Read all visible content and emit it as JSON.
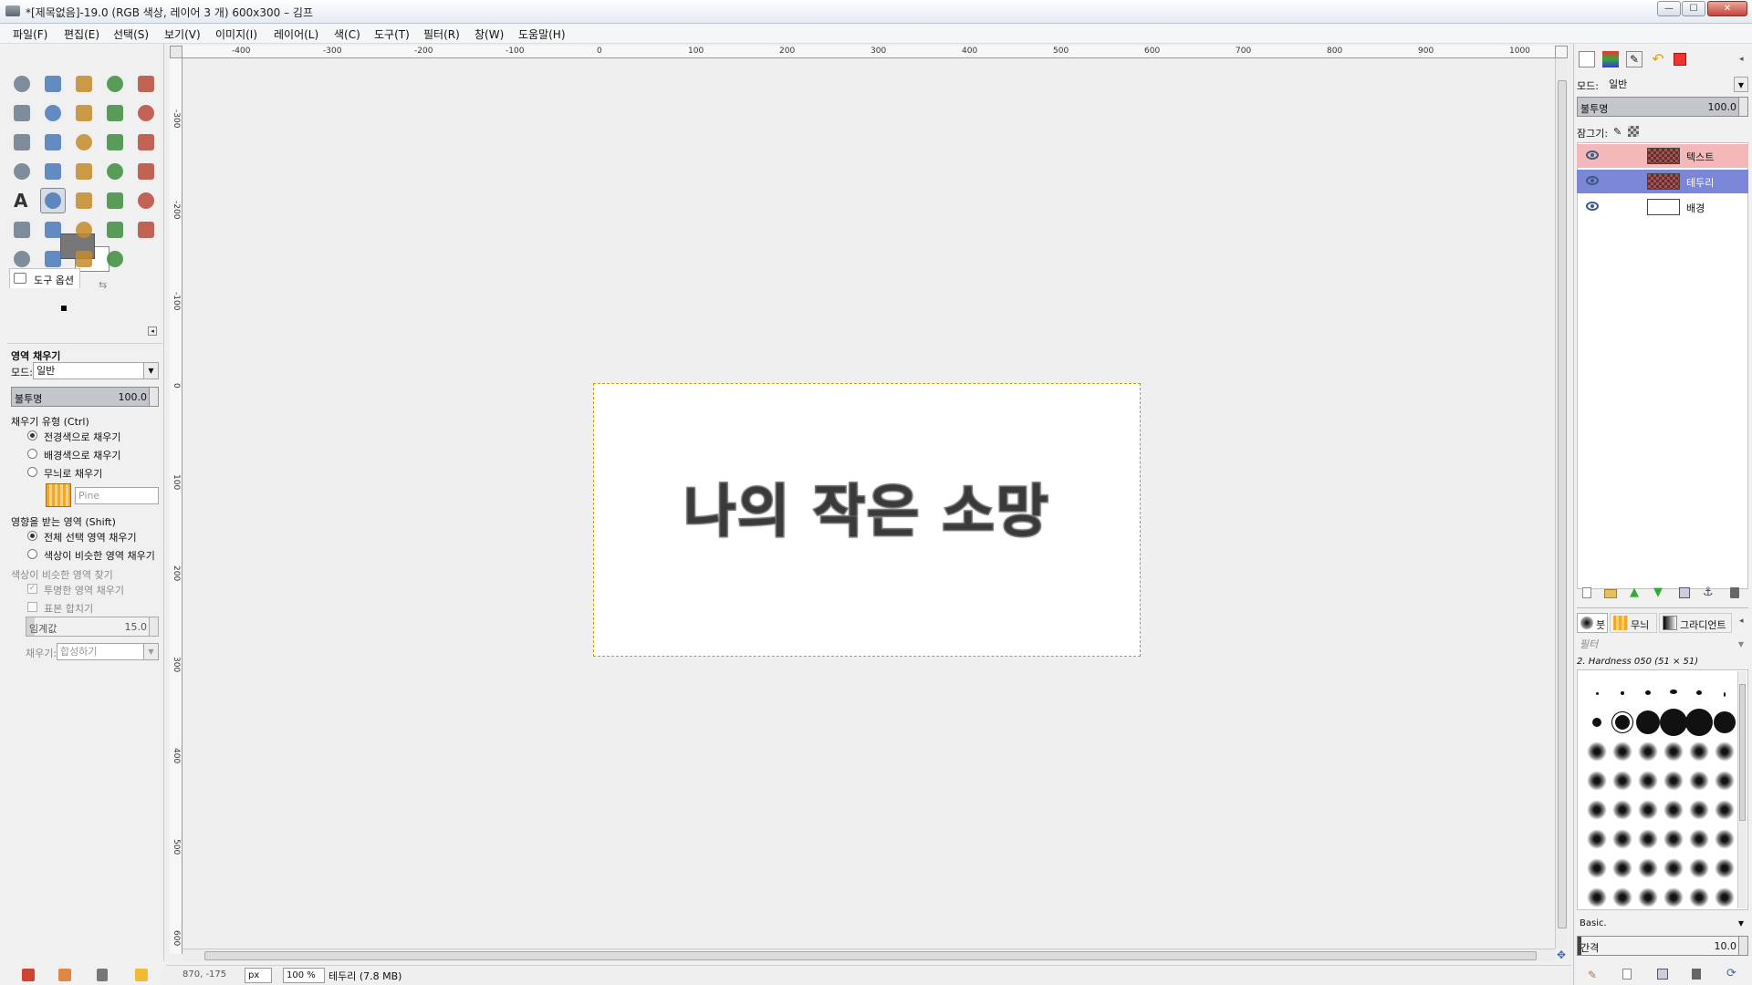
{
  "window": {
    "title": "*[제목없음]-19.0 (RGB 색상, 레이어 3 개) 600x300 – 김프",
    "buttons": {
      "minimize": "—",
      "maximize": "☐",
      "close": "✕"
    }
  },
  "menu": [
    "파일(F)",
    "편집(E)",
    "선택(S)",
    "보기(V)",
    "이미지(I)",
    "레이어(L)",
    "색(C)",
    "도구(T)",
    "필터(R)",
    "창(W)",
    "도움말(H)"
  ],
  "toolbox": {
    "tools": [
      "rect-select",
      "ellipse-select",
      "free-select",
      "fuzzy-select",
      "color-select",
      "scissors-select",
      "foreground-select",
      "paths",
      "color-picker",
      "zoom",
      "measure",
      "move",
      "align",
      "crop",
      "rotate",
      "scale",
      "shear",
      "perspective",
      "flip",
      "cage-transform",
      "text",
      "bucket-fill",
      "blend",
      "pencil",
      "paintbrush",
      "eraser",
      "airbrush",
      "ink",
      "clone",
      "heal",
      "perspective-clone",
      "blur",
      "smudge",
      "dodge-burn"
    ],
    "active_tool": "bucket-fill"
  },
  "tool_options": {
    "tab_label": "도구 옵션",
    "heading": "영역 채우기",
    "mode_label": "모드:",
    "mode_value": "일반",
    "opacity_label": "불투명",
    "opacity_value": "100.0",
    "opacity_fraction": 1.0,
    "fill_type_label": "채우기 유형  (Ctrl)",
    "fill_fg": "전경색으로 채우기",
    "fill_bg": "배경색으로 채우기",
    "fill_pattern": "무늬로 채우기",
    "pattern_name": "Pine",
    "affected_label": "영향을 받는 영역  (Shift)",
    "affected_selection": "전체 선택 영역 채우기",
    "affected_similar": "색상이 비슷한 영역 채우기",
    "find_similar_label": "색상이 비슷한 영역 찾기",
    "fill_transparent": "투명한 영역 채우기",
    "sample_merged": "표본 합치기",
    "threshold_label": "임계값",
    "threshold_value": "15.0",
    "threshold_fraction": 0.06,
    "fill_by_label": "채우기:",
    "fill_by_value": "합성하기"
  },
  "rulers": {
    "horizontal": [
      "-400",
      "-300",
      "-200",
      "-100",
      "0",
      "100",
      "200",
      "300",
      "400",
      "500",
      "600",
      "700",
      "800",
      "900",
      "1000"
    ],
    "vertical": [
      "-300",
      "-200",
      "-100",
      "0",
      "100",
      "200",
      "300",
      "400",
      "500",
      "600"
    ]
  },
  "canvas": {
    "image_text": "나의 작은 소망",
    "image_bg": "#ffffff",
    "selection_color": "#b8a200"
  },
  "statusbar": {
    "coords": "870, -175",
    "unit": "px",
    "zoom": "100 %",
    "message": "테두리 (7.8 MB)"
  },
  "layers_panel": {
    "mode_label": "모드:",
    "mode_value": "일반",
    "opacity_label": "불투명",
    "opacity_value": "100.0",
    "lock_label": "잠그기:",
    "layers": [
      {
        "name": "텍스트",
        "visible": true,
        "state": "normal",
        "thumb": "checker"
      },
      {
        "name": "테두리",
        "visible": true,
        "state": "selected",
        "thumb": "checker"
      },
      {
        "name": "배경",
        "visible": true,
        "state": "normal",
        "thumb": "white"
      }
    ]
  },
  "brushes_panel": {
    "tabs": [
      "붓",
      "무늬",
      "그라디언트"
    ],
    "filter_placeholder": "필터",
    "current_brush": "2. Hardness 050 (51 × 51)",
    "preset": "Basic.",
    "spacing_label": "간격",
    "spacing_value": "10.0"
  },
  "colors": {
    "accent_selected": "#7b86d6",
    "layer_text_row": "#f4b8b8",
    "foreground": "#777777",
    "background": "#ffffff"
  }
}
